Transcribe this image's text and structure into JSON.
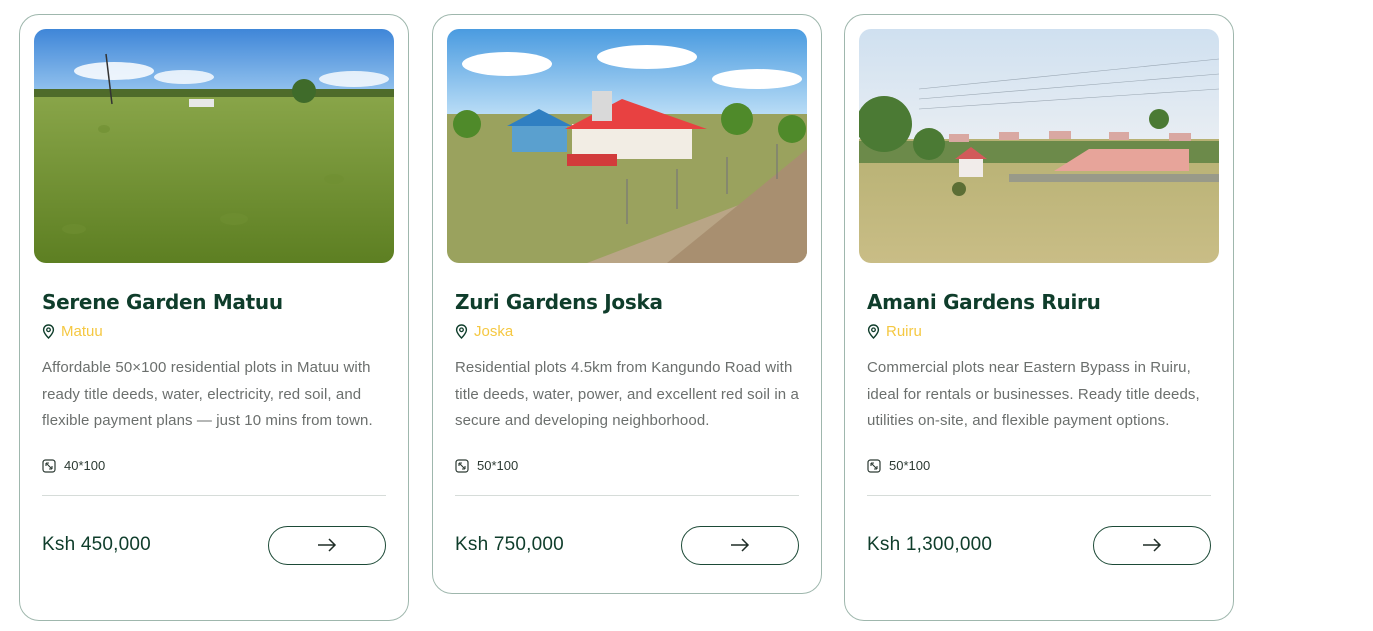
{
  "listings": [
    {
      "title": "Serene Garden Matuu",
      "location": "Matuu",
      "description": "Affordable 50×100 residential plots in Matuu with ready title deeds, water, electricity, red soil, and flexible payment plans — just 10 mins from town.",
      "size": "40*100",
      "price": "Ksh 450,000"
    },
    {
      "title": "Zuri Gardens Joska",
      "location": "Joska",
      "description": "Residential plots 4.5km from Kangundo Road with title deeds, water, power, and excellent red soil in a secure and developing neighborhood.",
      "size": "50*100",
      "price": "Ksh 750,000"
    },
    {
      "title": "Amani Gardens Ruiru",
      "location": "Ruiru",
      "description": "Commercial plots near Eastern Bypass in Ruiru, ideal for rentals or businesses. Ready title deeds, utilities on-site, and flexible payment options.",
      "size": "50*100",
      "price": "Ksh 1,300,000"
    }
  ],
  "colors": {
    "brand_green": "#0f3d2b",
    "location_yellow": "#f5c842",
    "card_border": "#9fb7ad"
  },
  "icons": {
    "location": "map-pin-icon",
    "size": "resize-icon",
    "action": "arrow-right-icon"
  }
}
